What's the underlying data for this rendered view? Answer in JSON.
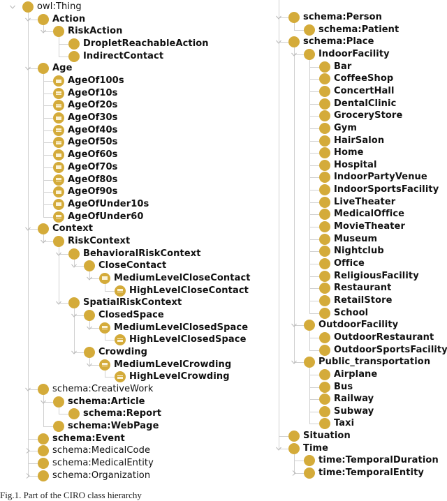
{
  "colors": {
    "class_circle": "#d4ab3a",
    "connector": "#d0d0d0",
    "text": "#111111"
  },
  "left_tree": [
    {
      "label": "owl:Thing",
      "depth": 0,
      "type": "class",
      "bold": false,
      "toggle": "expanded"
    },
    {
      "label": "Action",
      "depth": 1,
      "type": "class",
      "bold": true,
      "toggle": "expanded"
    },
    {
      "label": "RiskAction",
      "depth": 2,
      "type": "class",
      "bold": true,
      "toggle": "expanded"
    },
    {
      "label": "DropletReachableAction",
      "depth": 3,
      "type": "class",
      "bold": true,
      "toggle": "none"
    },
    {
      "label": "IndirectContact",
      "depth": 3,
      "type": "class",
      "bold": true,
      "toggle": "none"
    },
    {
      "label": "Age",
      "depth": 1,
      "type": "class",
      "bold": true,
      "toggle": "expanded"
    },
    {
      "label": "AgeOf100s",
      "depth": 2,
      "type": "individual",
      "bold": true,
      "toggle": "none"
    },
    {
      "label": "AgeOf10s",
      "depth": 2,
      "type": "individual",
      "bold": true,
      "toggle": "none"
    },
    {
      "label": "AgeOf20s",
      "depth": 2,
      "type": "individual",
      "bold": true,
      "toggle": "none"
    },
    {
      "label": "AgeOf30s",
      "depth": 2,
      "type": "individual",
      "bold": true,
      "toggle": "none"
    },
    {
      "label": "AgeOf40s",
      "depth": 2,
      "type": "individual",
      "bold": true,
      "toggle": "none"
    },
    {
      "label": "AgeOf50s",
      "depth": 2,
      "type": "individual",
      "bold": true,
      "toggle": "none"
    },
    {
      "label": "AgeOf60s",
      "depth": 2,
      "type": "individual",
      "bold": true,
      "toggle": "none"
    },
    {
      "label": "AgeOf70s",
      "depth": 2,
      "type": "individual",
      "bold": true,
      "toggle": "none"
    },
    {
      "label": "AgeOf80s",
      "depth": 2,
      "type": "individual",
      "bold": true,
      "toggle": "none"
    },
    {
      "label": "AgeOf90s",
      "depth": 2,
      "type": "individual",
      "bold": true,
      "toggle": "none"
    },
    {
      "label": "AgeOfUnder10s",
      "depth": 2,
      "type": "individual",
      "bold": true,
      "toggle": "none"
    },
    {
      "label": "AgeOfUnder60",
      "depth": 2,
      "type": "individual",
      "bold": true,
      "toggle": "none"
    },
    {
      "label": "Context",
      "depth": 1,
      "type": "class",
      "bold": true,
      "toggle": "expanded"
    },
    {
      "label": "RiskContext",
      "depth": 2,
      "type": "class",
      "bold": true,
      "toggle": "expanded"
    },
    {
      "label": "BehavioralRiskContext",
      "depth": 3,
      "type": "class",
      "bold": true,
      "toggle": "expanded"
    },
    {
      "label": "CloseContact",
      "depth": 4,
      "type": "class",
      "bold": true,
      "toggle": "expanded"
    },
    {
      "label": "MediumLevelCloseContact",
      "depth": 5,
      "type": "individual",
      "bold": true,
      "toggle": "expanded"
    },
    {
      "label": "HighLevelCloseContact",
      "depth": 6,
      "type": "individual",
      "bold": true,
      "toggle": "none"
    },
    {
      "label": "SpatialRiskContext",
      "depth": 3,
      "type": "class",
      "bold": true,
      "toggle": "expanded"
    },
    {
      "label": "ClosedSpace",
      "depth": 4,
      "type": "class",
      "bold": true,
      "toggle": "expanded"
    },
    {
      "label": "MediumLevelClosedSpace",
      "depth": 5,
      "type": "individual",
      "bold": true,
      "toggle": "expanded"
    },
    {
      "label": "HighLevelClosedSpace",
      "depth": 6,
      "type": "individual",
      "bold": true,
      "toggle": "none"
    },
    {
      "label": "Crowding",
      "depth": 4,
      "type": "class",
      "bold": true,
      "toggle": "expanded"
    },
    {
      "label": "MediumLevelCrowding",
      "depth": 5,
      "type": "individual",
      "bold": true,
      "toggle": "expanded"
    },
    {
      "label": "HighLevelCrowding",
      "depth": 6,
      "type": "individual",
      "bold": true,
      "toggle": "none"
    },
    {
      "label": "schema:CreativeWork",
      "depth": 1,
      "type": "class",
      "bold": false,
      "toggle": "expanded"
    },
    {
      "label": "schema:Article",
      "depth": 2,
      "type": "class",
      "bold": true,
      "toggle": "expanded"
    },
    {
      "label": "schema:Report",
      "depth": 3,
      "type": "class",
      "bold": true,
      "toggle": "none"
    },
    {
      "label": "schema:WebPage",
      "depth": 2,
      "type": "class",
      "bold": true,
      "toggle": "none"
    },
    {
      "label": "schema:Event",
      "depth": 1,
      "type": "class",
      "bold": true,
      "toggle": "none"
    },
    {
      "label": "schema:MedicalCode",
      "depth": 1,
      "type": "class",
      "bold": false,
      "toggle": "collapsed"
    },
    {
      "label": "schema:MedicalEntity",
      "depth": 1,
      "type": "class",
      "bold": false,
      "toggle": "none"
    },
    {
      "label": "schema:Organization",
      "depth": 1,
      "type": "class",
      "bold": false,
      "toggle": "collapsed"
    }
  ],
  "right_tree": [
    {
      "label": "schema:Person",
      "depth": 1,
      "type": "class",
      "bold": true,
      "toggle": "expanded"
    },
    {
      "label": "schema:Patient",
      "depth": 2,
      "type": "class",
      "bold": true,
      "toggle": "none"
    },
    {
      "label": "schema:Place",
      "depth": 1,
      "type": "class",
      "bold": true,
      "toggle": "expanded"
    },
    {
      "label": "IndoorFacility",
      "depth": 2,
      "type": "class",
      "bold": true,
      "toggle": "expanded"
    },
    {
      "label": "Bar",
      "depth": 3,
      "type": "class",
      "bold": true,
      "toggle": "none"
    },
    {
      "label": "CoffeeShop",
      "depth": 3,
      "type": "class",
      "bold": true,
      "toggle": "none"
    },
    {
      "label": "ConcertHall",
      "depth": 3,
      "type": "class",
      "bold": true,
      "toggle": "none"
    },
    {
      "label": "DentalClinic",
      "depth": 3,
      "type": "class",
      "bold": true,
      "toggle": "none"
    },
    {
      "label": "GroceryStore",
      "depth": 3,
      "type": "class",
      "bold": true,
      "toggle": "none"
    },
    {
      "label": "Gym",
      "depth": 3,
      "type": "class",
      "bold": true,
      "toggle": "none"
    },
    {
      "label": "HairSalon",
      "depth": 3,
      "type": "class",
      "bold": true,
      "toggle": "none"
    },
    {
      "label": "Home",
      "depth": 3,
      "type": "class",
      "bold": true,
      "toggle": "none"
    },
    {
      "label": "Hospital",
      "depth": 3,
      "type": "class",
      "bold": true,
      "toggle": "none"
    },
    {
      "label": "IndoorPartyVenue",
      "depth": 3,
      "type": "class",
      "bold": true,
      "toggle": "none"
    },
    {
      "label": "IndoorSportsFacility",
      "depth": 3,
      "type": "class",
      "bold": true,
      "toggle": "none"
    },
    {
      "label": "LiveTheater",
      "depth": 3,
      "type": "class",
      "bold": true,
      "toggle": "none"
    },
    {
      "label": "MedicalOffice",
      "depth": 3,
      "type": "class",
      "bold": true,
      "toggle": "none"
    },
    {
      "label": "MovieTheater",
      "depth": 3,
      "type": "class",
      "bold": true,
      "toggle": "none"
    },
    {
      "label": "Museum",
      "depth": 3,
      "type": "class",
      "bold": true,
      "toggle": "none"
    },
    {
      "label": "Nightclub",
      "depth": 3,
      "type": "class",
      "bold": true,
      "toggle": "none"
    },
    {
      "label": "Office",
      "depth": 3,
      "type": "class",
      "bold": true,
      "toggle": "none"
    },
    {
      "label": "ReligiousFacility",
      "depth": 3,
      "type": "class",
      "bold": true,
      "toggle": "none"
    },
    {
      "label": "Restaurant",
      "depth": 3,
      "type": "class",
      "bold": true,
      "toggle": "none"
    },
    {
      "label": "RetailStore",
      "depth": 3,
      "type": "class",
      "bold": true,
      "toggle": "none"
    },
    {
      "label": "School",
      "depth": 3,
      "type": "class",
      "bold": true,
      "toggle": "none"
    },
    {
      "label": "OutdoorFacility",
      "depth": 2,
      "type": "class",
      "bold": true,
      "toggle": "expanded"
    },
    {
      "label": "OutdoorRestaurant",
      "depth": 3,
      "type": "class",
      "bold": true,
      "toggle": "none"
    },
    {
      "label": "OutdoorSportsFacility",
      "depth": 3,
      "type": "class",
      "bold": true,
      "toggle": "none"
    },
    {
      "label": "Public_transportation",
      "depth": 2,
      "type": "class",
      "bold": true,
      "toggle": "expanded"
    },
    {
      "label": "Airplane",
      "depth": 3,
      "type": "class",
      "bold": true,
      "toggle": "none"
    },
    {
      "label": "Bus",
      "depth": 3,
      "type": "class",
      "bold": true,
      "toggle": "none"
    },
    {
      "label": "Railway",
      "depth": 3,
      "type": "class",
      "bold": true,
      "toggle": "none"
    },
    {
      "label": "Subway",
      "depth": 3,
      "type": "class",
      "bold": true,
      "toggle": "none"
    },
    {
      "label": "Taxi",
      "depth": 3,
      "type": "class",
      "bold": true,
      "toggle": "none"
    },
    {
      "label": "Situation",
      "depth": 1,
      "type": "class",
      "bold": true,
      "toggle": "none"
    },
    {
      "label": "Time",
      "depth": 1,
      "type": "class",
      "bold": true,
      "toggle": "expanded"
    },
    {
      "label": "time:TemporalDuration",
      "depth": 2,
      "type": "class",
      "bold": true,
      "toggle": "none"
    },
    {
      "label": "time:TemporalEntity",
      "depth": 2,
      "type": "class",
      "bold": true,
      "toggle": "collapsed"
    }
  ],
  "caption": "Fig.1. Part of the CIRO class hierarchy"
}
